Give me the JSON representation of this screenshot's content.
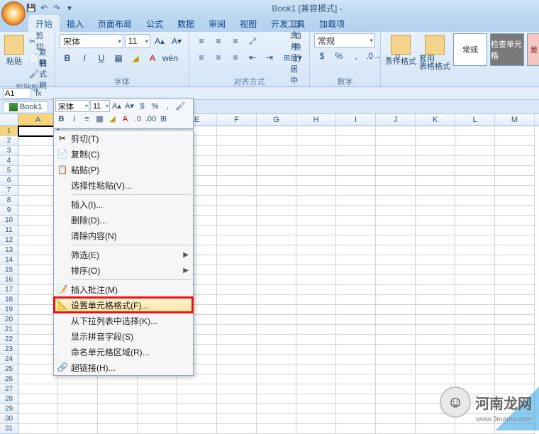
{
  "title": "Book1 [兼容模式] -",
  "qat": {
    "save": "💾",
    "undo": "↶",
    "redo": "↷",
    "more": "▾"
  },
  "tabs": [
    "开始",
    "插入",
    "页面布局",
    "公式",
    "数据",
    "审阅",
    "视图",
    "开发工具",
    "加载项"
  ],
  "active_tab": 0,
  "ribbon": {
    "clipboard": {
      "label": "剪贴板",
      "paste": "粘贴",
      "cut": "剪切",
      "copy": "复制",
      "fmtpaint": "格式刷"
    },
    "font": {
      "label": "字体",
      "name": "宋体",
      "size": "11"
    },
    "align": {
      "label": "对齐方式",
      "wrap": "自动换行",
      "merge": "合并后居中"
    },
    "number": {
      "label": "数字",
      "format": "常规"
    },
    "styles": {
      "cond": "条件格式",
      "table": "套用\n表格格式",
      "normal": "常规",
      "check": "检查单元格",
      "bad": "差"
    }
  },
  "namebox": "A1",
  "booktab": "Book1",
  "mini": {
    "font": "宋体",
    "size": "11"
  },
  "columns": [
    "A",
    "B",
    "C",
    "D",
    "E",
    "F",
    "G",
    "H",
    "I",
    "J",
    "K",
    "L",
    "M"
  ],
  "rows": 31,
  "context_menu": [
    {
      "icon": "✂",
      "label": "剪切(T)"
    },
    {
      "icon": "📄",
      "label": "复制(C)"
    },
    {
      "icon": "📋",
      "label": "粘贴(P)"
    },
    {
      "label": "选择性粘贴(V)..."
    },
    {
      "sep": true
    },
    {
      "label": "插入(I)..."
    },
    {
      "label": "删除(D)..."
    },
    {
      "label": "清除内容(N)"
    },
    {
      "sep": true
    },
    {
      "label": "筛选(E)",
      "sub": true
    },
    {
      "label": "排序(O)",
      "sub": true
    },
    {
      "sep": true
    },
    {
      "icon": "📝",
      "label": "插入批注(M)"
    },
    {
      "icon": "📐",
      "label": "设置单元格格式(F)...",
      "hl": true
    },
    {
      "label": "从下拉列表中选择(K)..."
    },
    {
      "label": "显示拼音字段(S)"
    },
    {
      "label": "命名单元格区域(R)..."
    },
    {
      "icon": "🔗",
      "label": "超链接(H)..."
    }
  ],
  "watermark": {
    "text": "河南龙网",
    "url": "www.3mama.com"
  }
}
